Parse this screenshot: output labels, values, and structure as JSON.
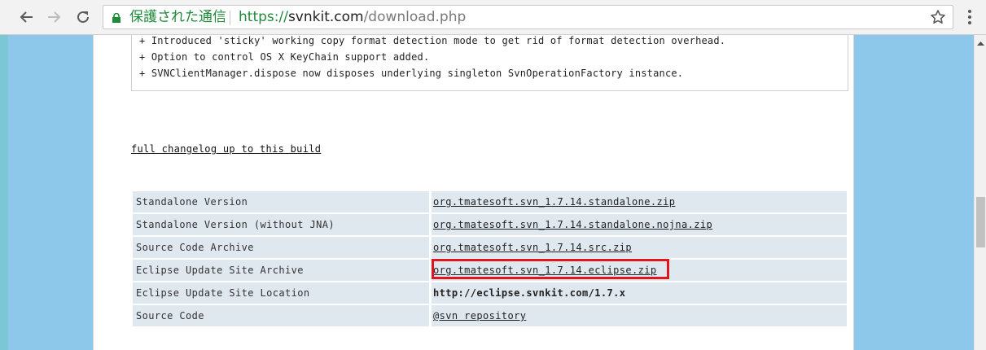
{
  "browser": {
    "secure_label": "保護された通信",
    "url_scheme": "https://",
    "url_host": "svnkit.com",
    "url_path": "/download.php",
    "back_icon": "back-arrow-icon",
    "forward_icon": "forward-arrow-icon",
    "reload_icon": "reload-icon",
    "bookmark_icon": "star-icon",
    "menu_icon": "vertical-dots-icon"
  },
  "changes": [
    "+ Introduced 'sticky' working copy format detection mode to get rid of format detection overhead.",
    "+ Option to control OS X KeyChain support added.",
    "+ SVNClientManager.dispose now disposes underlying singleton SvnOperationFactory instance."
  ],
  "changelog_link": "full changelog up to this build",
  "downloads": [
    {
      "label": "Standalone Version",
      "value": "org.tmatesoft.svn_1.7.14.standalone.zip",
      "kind": "link"
    },
    {
      "label": "Standalone Version (without JNA)",
      "value": "org.tmatesoft.svn_1.7.14.standalone.nojna.zip",
      "kind": "link"
    },
    {
      "label": "Source Code Archive",
      "value": "org.tmatesoft.svn_1.7.14.src.zip",
      "kind": "link"
    },
    {
      "label": "Eclipse Update Site Archive",
      "value": "org.tmatesoft.svn_1.7.14.eclipse.zip",
      "kind": "link"
    },
    {
      "label": "Eclipse Update Site Location",
      "value": "http://eclipse.svnkit.com/1.7.x",
      "kind": "text"
    },
    {
      "label": "Source Code",
      "value": "@svn repository",
      "kind": "link"
    }
  ],
  "colors": {
    "secure": "#1e8a3a",
    "page_background": "#8dc8eb",
    "row_background": "#dfe7ef",
    "highlight": "#e0161c"
  }
}
